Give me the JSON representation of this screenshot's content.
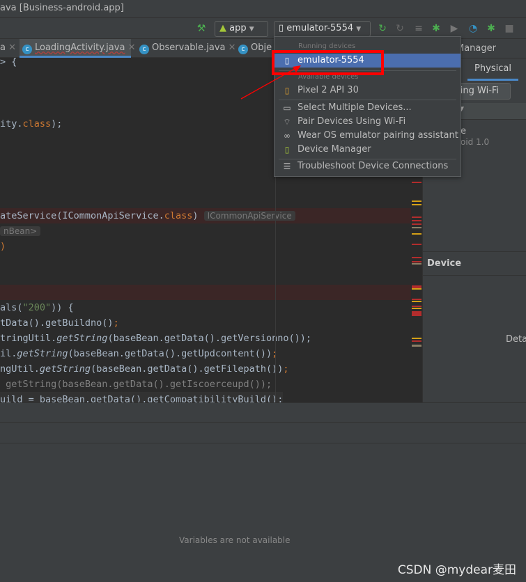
{
  "window": {
    "title": "ava [Business-android.app]"
  },
  "toolbar": {
    "config": "app",
    "device": "emulator-5554"
  },
  "tabs": [
    {
      "label": "a"
    },
    {
      "label": "LoadingActivity.java",
      "active": true
    },
    {
      "label": "Observable.java"
    },
    {
      "label": "Obje"
    }
  ],
  "code": {
    "l1": "> {",
    "l2a": "ity.",
    "l2b": "class",
    "l2c": ");",
    "l3a": "ateService(ICommonApiService.",
    "l3b": "class",
    "l3c": ")",
    "l3hint": "ICommonApiService",
    "l4hint": "nBean>",
    "l5": ")",
    "l6a": "als(",
    "l6b": "\"200\"",
    "l6c": ")) {",
    "l7a": "tData().getBuildno()",
    "l7b": ";",
    "l8a": "tringUtil.",
    "l8b": "getString",
    "l8c": "(baseBean.getData().getVersionno());",
    "l9a": "il.",
    "l9b": "getString",
    "l9c": "(baseBean.getData().getUpdcontent())",
    "l9d": ";",
    "l10a": "ngUtil.",
    "l10b": "getString",
    "l10c": "(baseBean.getData().getFilepath())",
    "l10d": ";",
    "l11": " getString(baseBean.getData().getIscoerceupd());",
    "l12": "uild = baseBean.getData().getCompatibilityBuild();"
  },
  "right_panel": {
    "title": "Manager",
    "tab": "Physical",
    "pair_button": "sing Wi-Fi",
    "device_name": "e",
    "device_sub": "oid 1.0",
    "section": "Device",
    "details": "Detai"
  },
  "debugger": {
    "empty_text": "Variables are not available"
  },
  "device_menu": {
    "running_header": "Running devices",
    "running": [
      {
        "label": "emulator-5554",
        "selected": true
      }
    ],
    "available_header": "Available devices",
    "available": [
      {
        "label": "Pixel 2 API 30"
      }
    ],
    "actions": [
      {
        "label": "Select Multiple Devices...",
        "icon": "multi-device-icon"
      },
      {
        "label": "Pair Devices Using Wi-Fi",
        "icon": "wifi-icon"
      },
      {
        "label": "Wear OS emulator pairing assistant",
        "icon": "link-icon"
      },
      {
        "label": "Device Manager",
        "icon": "device-manager-icon"
      }
    ],
    "troubleshoot": "Troubleshoot Device Connections"
  },
  "colors": {
    "selection": "#4b6eaf",
    "annotation": "#ff0000"
  },
  "watermark": "CSDN @mydear麦田"
}
